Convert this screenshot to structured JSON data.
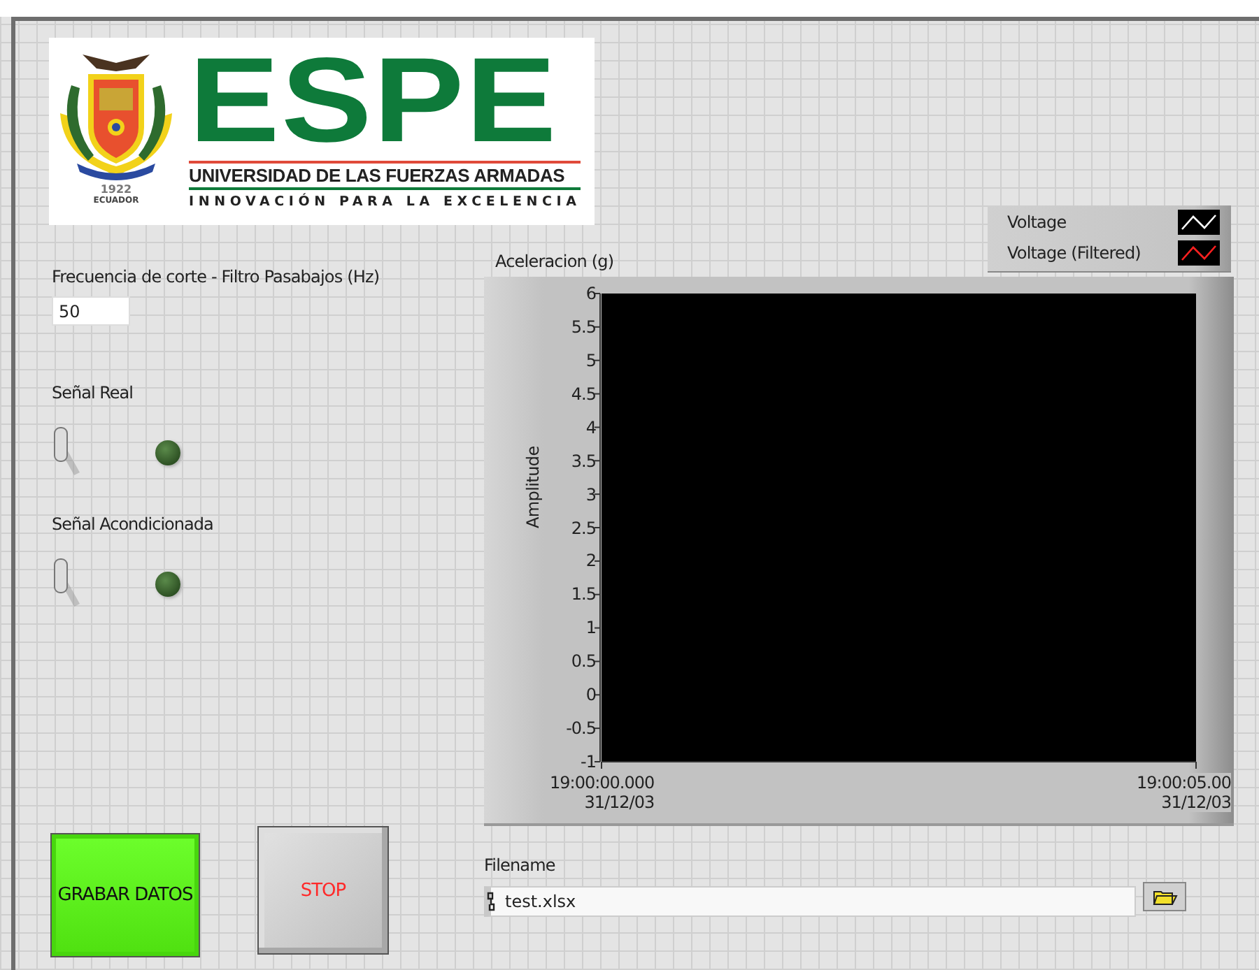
{
  "logo": {
    "wordmark": "ESPE",
    "name": "UNIVERSIDAD DE LAS FUERZAS ARMADAS",
    "motto": "INNOVACIÓN PARA LA EXCELENCIA",
    "crest_year": "1922",
    "crest_country": "ECUADOR"
  },
  "cutoff": {
    "label": "Frecuencia de corte  - Filtro Pasabajos (Hz)",
    "value": "50"
  },
  "indicators": [
    {
      "label": "Señal Real",
      "switch_on": false,
      "led_on": false
    },
    {
      "label": "Señal Acondicionada",
      "switch_on": false,
      "led_on": false
    }
  ],
  "chart": {
    "chart_data": {
      "type": "line",
      "title": "Aceleracion (g)",
      "ylabel": "Amplitude",
      "categories": [
        "19:00:00.000\n31/12/03",
        "19:00:05.00\n31/12/03"
      ],
      "series": [
        {
          "name": "Voltage",
          "color": "#ffffff",
          "values": [
            null,
            null
          ]
        },
        {
          "name": "Voltage (Filtered)",
          "color": "#ff2020",
          "values": [
            null,
            null
          ]
        }
      ],
      "ylim": [
        -1,
        6
      ],
      "yticks": [
        {
          "value": 6,
          "label": "6"
        },
        {
          "value": 5.5,
          "label": "5.5"
        },
        {
          "value": 5,
          "label": "5"
        },
        {
          "value": 4.5,
          "label": "4.5"
        },
        {
          "value": 4,
          "label": "4"
        },
        {
          "value": 3.5,
          "label": "3.5"
        },
        {
          "value": 3,
          "label": "3"
        },
        {
          "value": 2.5,
          "label": "2.5"
        },
        {
          "value": 2,
          "label": "2"
        },
        {
          "value": 1.5,
          "label": "1.5"
        },
        {
          "value": 1,
          "label": "1"
        },
        {
          "value": 0.5,
          "label": "0.5"
        },
        {
          "value": 0,
          "label": "0"
        },
        {
          "value": -0.5,
          "label": "-0.5"
        },
        {
          "value": -1,
          "label": "-1"
        }
      ]
    }
  },
  "buttons": [
    {
      "kind": "record",
      "label": "GRABAR DATOS"
    },
    {
      "kind": "stop",
      "label": "STOP"
    }
  ],
  "file": {
    "label": "Filename",
    "value": "test.xlsx"
  }
}
